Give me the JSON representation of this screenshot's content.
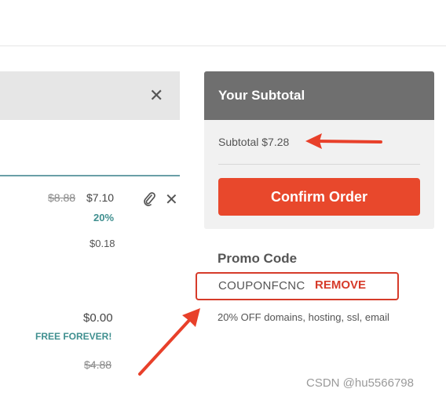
{
  "cart": {
    "item": {
      "original_price": "$8.88",
      "price": "$7.10",
      "discount": "20%",
      "fee": "$0.18"
    },
    "free_item": {
      "price": "$0.00",
      "label": "FREE FOREVER!",
      "original_price": "$4.88"
    }
  },
  "subtotal": {
    "title": "Your Subtotal",
    "line": "Subtotal $7.28",
    "confirm_label": "Confirm Order"
  },
  "promo": {
    "title": "Promo Code",
    "code": "COUPONFCNC",
    "remove_label": "REMOVE",
    "description": "20% OFF domains, hosting, ssl, email"
  },
  "watermark": "CSDN @hu5566798",
  "colors": {
    "accent_red": "#e8482c",
    "teal": "#3f8f8f",
    "header_gray": "#6f6f6f"
  },
  "icons": [
    "close-icon",
    "paperclip-icon"
  ]
}
